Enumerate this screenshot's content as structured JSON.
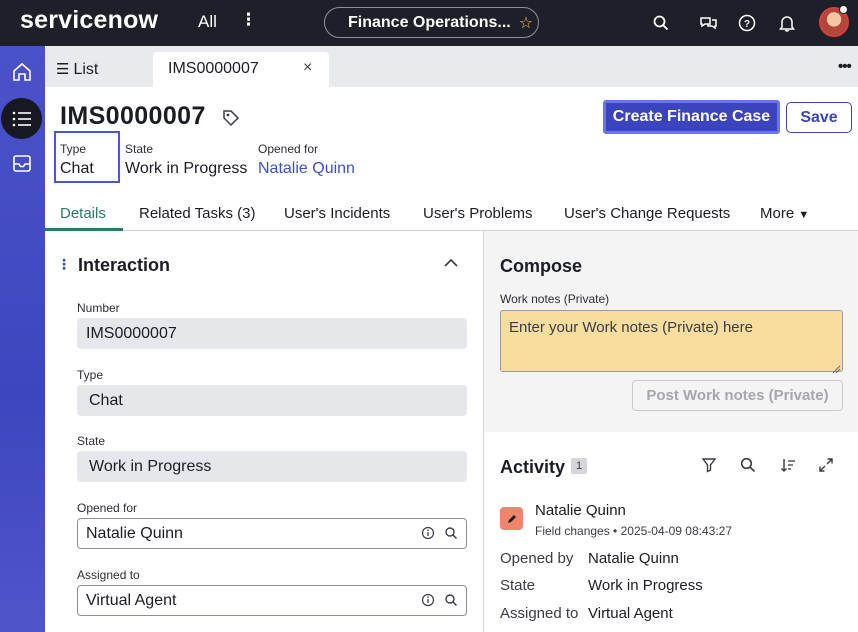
{
  "topbar": {
    "logo": "servicenow",
    "all_label": "All",
    "more_label": "⋮",
    "context_title": "Finance Operations...",
    "icons": [
      "search-icon",
      "chat-icon",
      "help-icon",
      "bell-icon",
      "avatar"
    ]
  },
  "rail": {
    "icons": [
      "home-icon",
      "list-icon",
      "inbox-icon"
    ]
  },
  "tabs": {
    "list_label": "List",
    "record_label": "IMS0000007",
    "close_label": "×",
    "overflow_label": "•••"
  },
  "header": {
    "title": "IMS0000007",
    "primary_action": "Create Finance Case",
    "save_label": "Save",
    "meta": [
      {
        "label": "Type",
        "value": "Chat"
      },
      {
        "label": "State",
        "value": "Work in Progress"
      },
      {
        "label": "Opened for",
        "value": "Natalie Quinn"
      }
    ]
  },
  "form_tabs": [
    "Details",
    "Related Tasks (3)",
    "User's Incidents",
    "User's Problems",
    "User's Change Requests",
    "More"
  ],
  "interaction": {
    "title": "Interaction",
    "fields": [
      {
        "label": "Number",
        "value": "IMS0000007"
      },
      {
        "label": "Type",
        "value": "Chat"
      },
      {
        "label": "State",
        "value": "Work in Progress"
      },
      {
        "label": "Opened for",
        "value": "Natalie Quinn"
      },
      {
        "label": "Assigned to",
        "value": "Virtual Agent"
      }
    ]
  },
  "compose": {
    "title": "Compose",
    "work_notes_label": "Work notes (Private)",
    "work_notes_placeholder": "Enter your Work notes (Private) here",
    "post_label": "Post Work notes (Private)"
  },
  "activity": {
    "title": "Activity",
    "count": "1",
    "entry": {
      "author": "Natalie Quinn",
      "kind": "Field changes",
      "timestamp": "2025-04-09 08:43:27",
      "changes": [
        {
          "field": "Opened by",
          "value": "Natalie Quinn"
        },
        {
          "field": "State",
          "value": "Work in Progress"
        },
        {
          "field": "Assigned to",
          "value": "Virtual Agent"
        }
      ]
    }
  },
  "colors": {
    "topbar": "#1e2029",
    "rail": "#4b52c9",
    "primary": "#3c44bd",
    "accent_tab": "#2a7d5f",
    "work_notes_bg": "#f8dd9f"
  }
}
